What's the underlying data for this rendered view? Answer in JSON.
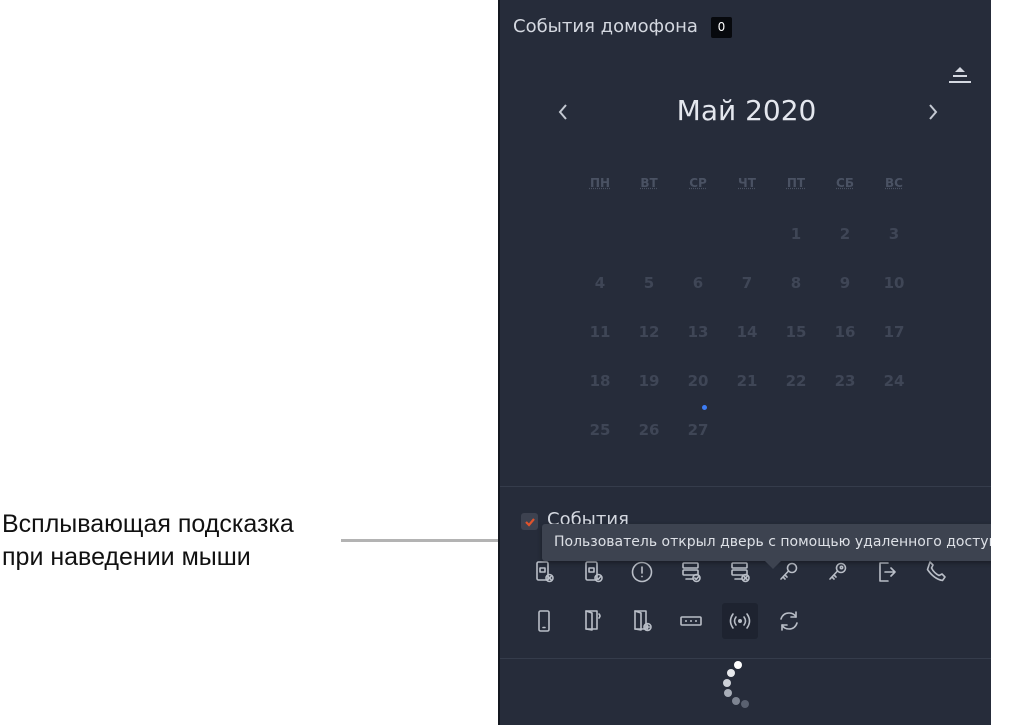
{
  "annotation": {
    "line1": "Всплывающая подсказка",
    "line2": "при наведении мыши"
  },
  "header": {
    "title": "События домофона",
    "badge": "0"
  },
  "calendar": {
    "month_title": "Май 2020",
    "weekdays": [
      "ПН",
      "ВТ",
      "СР",
      "ЧТ",
      "ПТ",
      "СБ",
      "ВС"
    ],
    "days": [
      "1",
      "2",
      "3",
      "4",
      "5",
      "6",
      "7",
      "8",
      "9",
      "10",
      "11",
      "12",
      "13",
      "14",
      "15",
      "16",
      "17",
      "18",
      "19",
      "20",
      "21",
      "22",
      "23",
      "24",
      "25",
      "26",
      "27"
    ]
  },
  "events": {
    "label": "События",
    "checked": true
  },
  "tooltip": {
    "text": "Пользователь открыл дверь с помощью удаленного доступа"
  },
  "filters": [
    {
      "name": "card-reject-icon"
    },
    {
      "name": "card-accept-icon"
    },
    {
      "name": "alert-icon"
    },
    {
      "name": "server-accept-icon"
    },
    {
      "name": "server-reject-icon"
    },
    {
      "name": "key-icon"
    },
    {
      "name": "key-outline-icon"
    },
    {
      "name": "exit-icon"
    },
    {
      "name": "phone-icon"
    },
    {
      "name": "mobile-icon"
    },
    {
      "name": "door-open-icon"
    },
    {
      "name": "door-add-icon"
    },
    {
      "name": "keypad-icon"
    },
    {
      "name": "remote-access-icon",
      "active": true
    },
    {
      "name": "sync-icon"
    }
  ],
  "colors": {
    "panel_bg": "#262c3a",
    "accent_blue": "#3d7df5",
    "check_red": "#e0532c",
    "tooltip_bg": "#3d4350"
  }
}
